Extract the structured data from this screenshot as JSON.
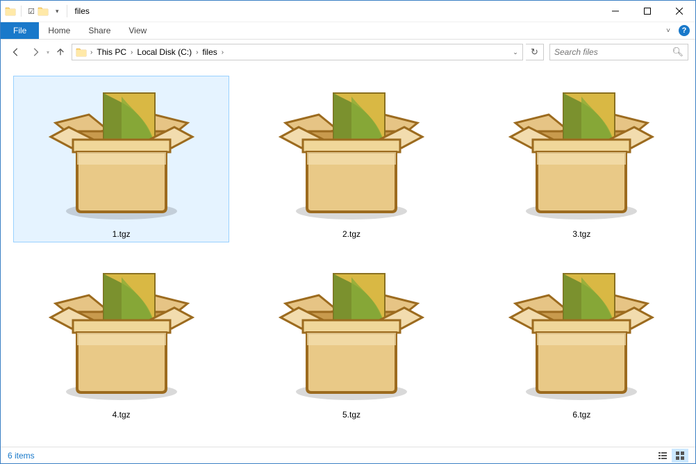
{
  "window": {
    "title": "files"
  },
  "ribbon": {
    "file": "File",
    "tabs": [
      "Home",
      "Share",
      "View"
    ]
  },
  "breadcrumb": {
    "parts": [
      "This PC",
      "Local Disk (C:)",
      "files"
    ]
  },
  "search": {
    "placeholder": "Search files"
  },
  "files": [
    {
      "name": "1.tgz",
      "selected": true
    },
    {
      "name": "2.tgz",
      "selected": false
    },
    {
      "name": "3.tgz",
      "selected": false
    },
    {
      "name": "4.tgz",
      "selected": false
    },
    {
      "name": "5.tgz",
      "selected": false
    },
    {
      "name": "6.tgz",
      "selected": false
    }
  ],
  "status": {
    "count": "6 items"
  }
}
